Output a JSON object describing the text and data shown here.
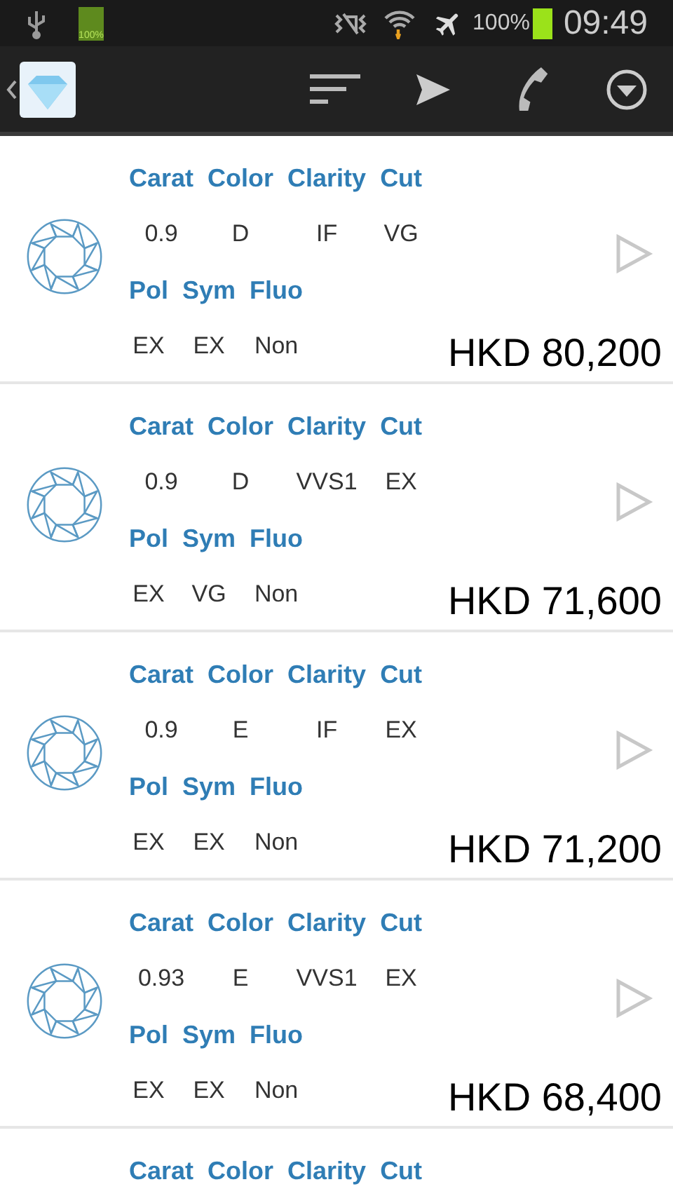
{
  "status_bar": {
    "battery_icon_label": "100%",
    "battery": "100%",
    "time": "09:49"
  },
  "listings": [
    {
      "headers_1": [
        "Carat",
        "Color",
        "Clarity",
        "Cut"
      ],
      "values_1": [
        "0.9",
        "D",
        "IF",
        "VG"
      ],
      "headers_2": [
        "Pol",
        "Sym",
        "Fluo"
      ],
      "values_2": [
        "EX",
        "EX",
        "Non"
      ],
      "price": "HKD 80,200"
    },
    {
      "headers_1": [
        "Carat",
        "Color",
        "Clarity",
        "Cut"
      ],
      "values_1": [
        "0.9",
        "D",
        "VVS1",
        "EX"
      ],
      "headers_2": [
        "Pol",
        "Sym",
        "Fluo"
      ],
      "values_2": [
        "EX",
        "VG",
        "Non"
      ],
      "price": "HKD 71,600"
    },
    {
      "headers_1": [
        "Carat",
        "Color",
        "Clarity",
        "Cut"
      ],
      "values_1": [
        "0.9",
        "E",
        "IF",
        "EX"
      ],
      "headers_2": [
        "Pol",
        "Sym",
        "Fluo"
      ],
      "values_2": [
        "EX",
        "EX",
        "Non"
      ],
      "price": "HKD 71,200"
    },
    {
      "headers_1": [
        "Carat",
        "Color",
        "Clarity",
        "Cut"
      ],
      "values_1": [
        "0.93",
        "E",
        "VVS1",
        "EX"
      ],
      "headers_2": [
        "Pol",
        "Sym",
        "Fluo"
      ],
      "values_2": [
        "EX",
        "EX",
        "Non"
      ],
      "price": "HKD 68,400"
    },
    {
      "headers_1": [
        "Carat",
        "Color",
        "Clarity",
        "Cut"
      ]
    }
  ]
}
